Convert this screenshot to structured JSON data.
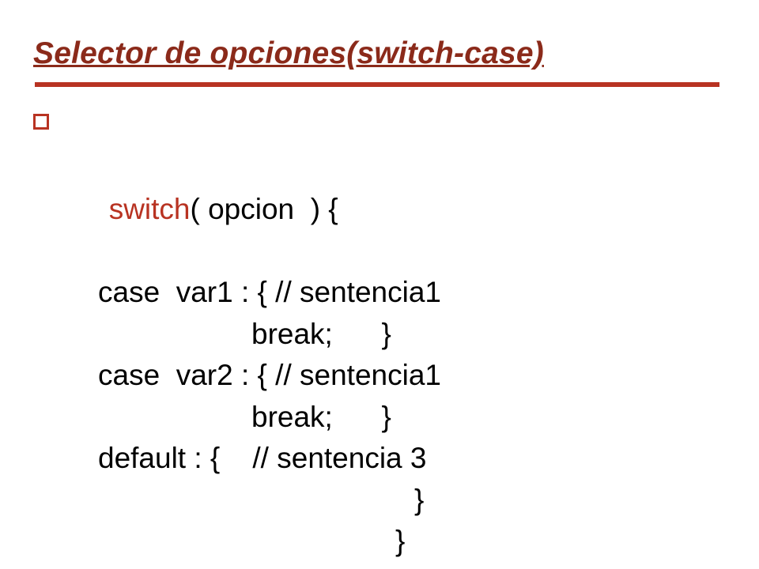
{
  "title": "Selector de opciones(switch-case)",
  "code": {
    "line1_kw": "switch",
    "line1_rest": "( opcion  ) {",
    "line2": "case  var1 : { // sentencia1",
    "line3": "break;      }",
    "line4": "case  var2 : { // sentencia1",
    "line5": "break;      }",
    "line6": "default : {    // sentencia 3",
    "line7": "}",
    "line8": "}"
  }
}
